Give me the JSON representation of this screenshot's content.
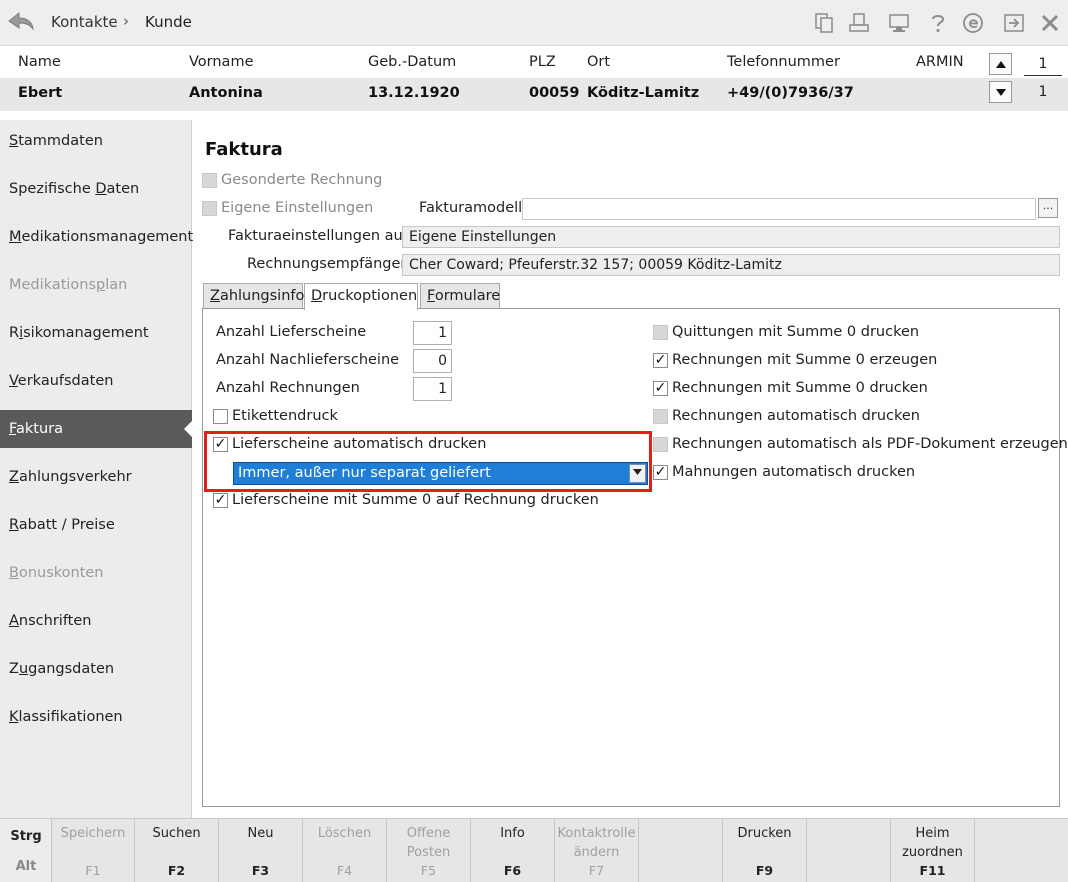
{
  "titlebar": {
    "breadcrumb_1": "Kontakte",
    "breadcrumb_sep": "›",
    "breadcrumb_2": "Kunde",
    "icons": [
      "copy-icon",
      "print-preview-icon",
      "monitor-icon",
      "help-icon",
      "info-e-icon",
      "export-icon",
      "close-icon"
    ]
  },
  "customer": {
    "headers": {
      "name": "Name",
      "vorname": "Vorname",
      "geb_datum": "Geb.-Datum",
      "plz": "PLZ",
      "ort": "Ort",
      "telefon": "Telefonnummer",
      "armin": "ARMIN"
    },
    "values": {
      "name": "Ebert",
      "vorname": "Antonina",
      "geb_datum": "13.12.1920",
      "plz": "00059",
      "ort": "Köditz-Lamitz",
      "telefon": "+49/(0)7936/37"
    },
    "count_top": "1",
    "count_bottom": "1"
  },
  "sidebar": {
    "items": [
      {
        "pre": "",
        "ul": "S",
        "post": "tammdaten"
      },
      {
        "pre": "Spezifische ",
        "ul": "D",
        "post": "aten"
      },
      {
        "pre": "",
        "ul": "M",
        "post": "edikationsmanagement"
      },
      {
        "pre": "Medikations",
        "ul": "p",
        "post": "lan"
      },
      {
        "pre": "R",
        "ul": "i",
        "post": "sikomanagement"
      },
      {
        "pre": "",
        "ul": "V",
        "post": "erkaufsdaten"
      },
      {
        "pre": "",
        "ul": "F",
        "post": "aktura"
      },
      {
        "pre": "",
        "ul": "Z",
        "post": "ahlungsverkehr"
      },
      {
        "pre": "",
        "ul": "R",
        "post": "abatt / Preise"
      },
      {
        "pre": "",
        "ul": "B",
        "post": "onuskonten"
      },
      {
        "pre": "",
        "ul": "A",
        "post": "nschriften"
      },
      {
        "pre": "Z",
        "ul": "u",
        "post": "gangsdaten"
      },
      {
        "pre": "",
        "ul": "K",
        "post": "lassifikationen"
      }
    ]
  },
  "main": {
    "title": "Faktura",
    "gesonderte_rechnung": "Gesonderte Rechnung",
    "eigene_einstellungen": "Eigene Einstellungen",
    "fakturamodell_label": "Fakturamodell",
    "fakturamodell_value": "",
    "fakturamodell_button": "...",
    "einstellungen_aus_label": "Fakturaeinstellungen aus",
    "einstellungen_aus_value": "Eigene Einstellungen",
    "empfaenger_label": "Rechnungsempfänger",
    "empfaenger_value": "Cher Coward; Pfeuferstr.32 157; 00059 Köditz-Lamitz"
  },
  "tabs": [
    {
      "pre": "",
      "ul": "Z",
      "post": "ahlungsinfo"
    },
    {
      "pre": "",
      "ul": "D",
      "post": "ruckoptionen"
    },
    {
      "pre": "",
      "ul": "F",
      "post": "ormulare"
    }
  ],
  "druck": {
    "anzahl_lieferscheine_label": "Anzahl Lieferscheine",
    "anzahl_lieferscheine": "1",
    "anzahl_nachlieferscheine_label": "Anzahl Nachlieferscheine",
    "anzahl_nachlieferscheine": "0",
    "anzahl_rechnungen_label": "Anzahl Rechnungen",
    "anzahl_rechnungen": "1",
    "etikettendruck": "Etikettendruck",
    "lieferscheine_auto": "Lieferscheine automatisch drucken",
    "lieferscheine_dropdown": "Immer, außer nur separat geliefert",
    "lieferscheine_summe0": "Lieferscheine mit Summe 0 auf Rechnung drucken",
    "quittungen_summe0": "Quittungen mit Summe 0 drucken",
    "rechnungen_summe0_erzeugen": "Rechnungen mit Summe 0 erzeugen",
    "rechnungen_summe0_drucken": "Rechnungen mit Summe 0 drucken",
    "rechnungen_auto_drucken": "Rechnungen automatisch drucken",
    "rechnungen_auto_pdf": "Rechnungen automatisch als PDF-Dokument erzeugen",
    "mahnungen_auto": "Mahnungen automatisch drucken",
    "check_mark": "✓"
  },
  "footer": {
    "strg": "Strg",
    "alt": "Alt",
    "keys": [
      {
        "label": "Speichern",
        "fkey": "F1"
      },
      {
        "label": "Suchen",
        "fkey": "F2"
      },
      {
        "label": "Neu",
        "fkey": "F3"
      },
      {
        "label": "Löschen",
        "fkey": "F4"
      },
      {
        "label": "Offene\nPosten",
        "fkey": "F5"
      },
      {
        "label": "Info",
        "fkey": "F6"
      },
      {
        "label": "Kontaktrolle\nändern",
        "fkey": "F7"
      },
      {
        "label": "",
        "fkey": ""
      },
      {
        "label": "Drucken",
        "fkey": "F9"
      },
      {
        "label": "",
        "fkey": ""
      },
      {
        "label": "Heim\nzuordnen",
        "fkey": "F11"
      },
      {
        "label": "",
        "fkey": ""
      }
    ]
  }
}
